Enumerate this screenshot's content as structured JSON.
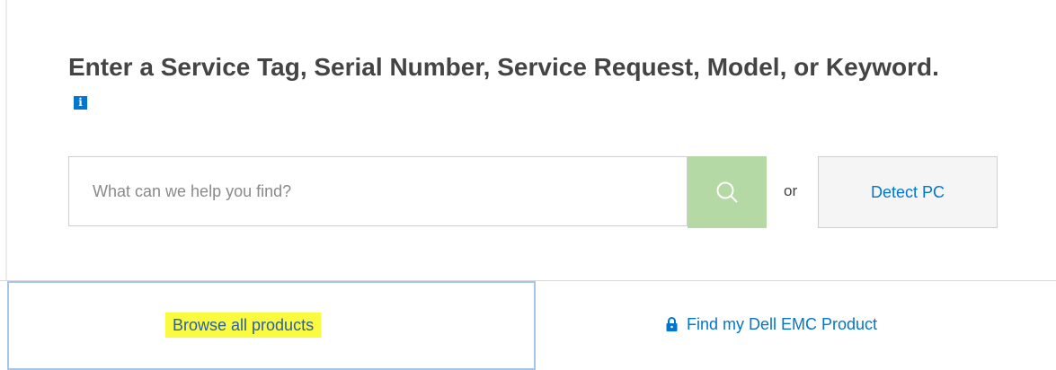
{
  "heading": {
    "text": "Enter a Service Tag, Serial Number, Service Request, Model, or Keyword.",
    "info_icon_glyph": "i",
    "info_icon": "info-icon"
  },
  "search": {
    "placeholder": "What can we help you find?",
    "value": "",
    "button_icon": "search-icon"
  },
  "or_text": "or",
  "detect_pc": {
    "label": "Detect PC"
  },
  "tabs": [
    {
      "label": "Browse all products",
      "highlighted": true,
      "selected": true
    },
    {
      "label": "Find my Dell EMC Product",
      "icon": "lock-icon"
    }
  ],
  "colors": {
    "link_blue": "#0076ce",
    "search_button_green": "#b5d9a4",
    "highlight_yellow": "#fafa40",
    "selected_tab_border": "#a7c4ec",
    "heading_text": "#444444"
  }
}
